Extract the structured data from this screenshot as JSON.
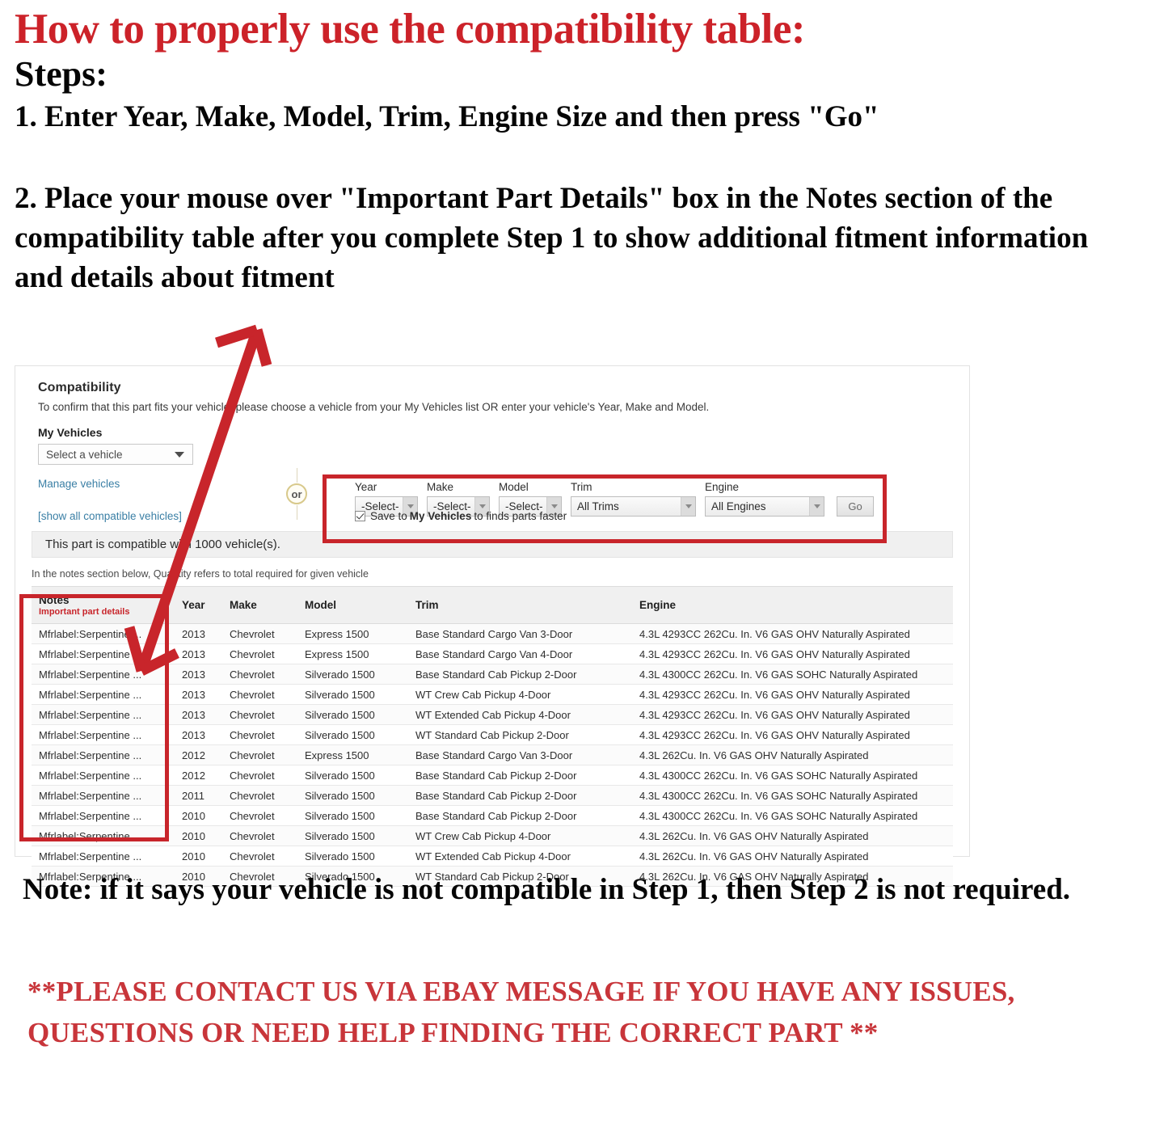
{
  "instructions": {
    "heading": "How to properly use the compatibility table:",
    "steps_label": "Steps:",
    "step1": "1. Enter Year, Make, Model, Trim, Engine Size and then press \"Go\"",
    "step2": "2. Place your mouse over \"Important Part Details\" box in the Notes section of the compatibility table after you complete Step 1 to show additional fitment information and details about fitment"
  },
  "panel": {
    "title": "Compatibility",
    "subtitle": "To confirm that this part fits your vehicle, please choose a vehicle from your My Vehicles list OR enter your vehicle's Year, Make and Model.",
    "my_vehicles_label": "My Vehicles",
    "vehicle_select_value": "Select a vehicle",
    "manage_vehicles_link": "Manage vehicles",
    "show_all_link": "[show all compatible vehicles]",
    "or_label": "or",
    "compatible_banner": "This part is compatible with 1000 vehicle(s).",
    "notes_hint": "In the notes section below, Quantity refers to total required for given vehicle"
  },
  "picker": {
    "fields": [
      {
        "label": "Year",
        "value": "-Select-"
      },
      {
        "label": "Make",
        "value": "-Select-"
      },
      {
        "label": "Model",
        "value": "-Select-"
      },
      {
        "label": "Trim",
        "value": "All Trims"
      },
      {
        "label": "Engine",
        "value": "All Engines"
      }
    ],
    "go_label": "Go",
    "save_prefix": "Save to",
    "save_bold": "My Vehicles",
    "save_suffix": "to finds parts faster",
    "save_checked": true
  },
  "table": {
    "headers": {
      "notes": "Notes",
      "notes_sub": "Important part details",
      "year": "Year",
      "make": "Make",
      "model": "Model",
      "trim": "Trim",
      "engine": "Engine"
    },
    "rows": [
      {
        "notes": "Mfrlabel:Serpentine ...",
        "year": "2013",
        "make": "Chevrolet",
        "model": "Express 1500",
        "trim": "Base Standard Cargo Van 3-Door",
        "engine": "4.3L 4293CC 262Cu. In. V6 GAS OHV Naturally Aspirated"
      },
      {
        "notes": "Mfrlabel:Serpentine ...",
        "year": "2013",
        "make": "Chevrolet",
        "model": "Express 1500",
        "trim": "Base Standard Cargo Van 4-Door",
        "engine": "4.3L 4293CC 262Cu. In. V6 GAS OHV Naturally Aspirated"
      },
      {
        "notes": "Mfrlabel:Serpentine ...",
        "year": "2013",
        "make": "Chevrolet",
        "model": "Silverado 1500",
        "trim": "Base Standard Cab Pickup 2-Door",
        "engine": "4.3L 4300CC 262Cu. In. V6 GAS SOHC Naturally Aspirated"
      },
      {
        "notes": "Mfrlabel:Serpentine ...",
        "year": "2013",
        "make": "Chevrolet",
        "model": "Silverado 1500",
        "trim": "WT Crew Cab Pickup 4-Door",
        "engine": "4.3L 4293CC 262Cu. In. V6 GAS OHV Naturally Aspirated"
      },
      {
        "notes": "Mfrlabel:Serpentine ...",
        "year": "2013",
        "make": "Chevrolet",
        "model": "Silverado 1500",
        "trim": "WT Extended Cab Pickup 4-Door",
        "engine": "4.3L 4293CC 262Cu. In. V6 GAS OHV Naturally Aspirated"
      },
      {
        "notes": "Mfrlabel:Serpentine ...",
        "year": "2013",
        "make": "Chevrolet",
        "model": "Silverado 1500",
        "trim": "WT Standard Cab Pickup 2-Door",
        "engine": "4.3L 4293CC 262Cu. In. V6 GAS OHV Naturally Aspirated"
      },
      {
        "notes": "Mfrlabel:Serpentine ...",
        "year": "2012",
        "make": "Chevrolet",
        "model": "Express 1500",
        "trim": "Base Standard Cargo Van 3-Door",
        "engine": "4.3L 262Cu. In. V6 GAS OHV Naturally Aspirated"
      },
      {
        "notes": "Mfrlabel:Serpentine ...",
        "year": "2012",
        "make": "Chevrolet",
        "model": "Silverado 1500",
        "trim": "Base Standard Cab Pickup 2-Door",
        "engine": "4.3L 4300CC 262Cu. In. V6 GAS SOHC Naturally Aspirated"
      },
      {
        "notes": "Mfrlabel:Serpentine ...",
        "year": "2011",
        "make": "Chevrolet",
        "model": "Silverado 1500",
        "trim": "Base Standard Cab Pickup 2-Door",
        "engine": "4.3L 4300CC 262Cu. In. V6 GAS SOHC Naturally Aspirated"
      },
      {
        "notes": "Mfrlabel:Serpentine ...",
        "year": "2010",
        "make": "Chevrolet",
        "model": "Silverado 1500",
        "trim": "Base Standard Cab Pickup 2-Door",
        "engine": "4.3L 4300CC 262Cu. In. V6 GAS SOHC Naturally Aspirated"
      },
      {
        "notes": "Mfrlabel:Serpentine ...",
        "year": "2010",
        "make": "Chevrolet",
        "model": "Silverado 1500",
        "trim": "WT Crew Cab Pickup 4-Door",
        "engine": "4.3L 262Cu. In. V6 GAS OHV Naturally Aspirated"
      },
      {
        "notes": "Mfrlabel:Serpentine ...",
        "year": "2010",
        "make": "Chevrolet",
        "model": "Silverado 1500",
        "trim": "WT Extended Cab Pickup 4-Door",
        "engine": "4.3L 262Cu. In. V6 GAS OHV Naturally Aspirated"
      },
      {
        "notes": "Mfrlabel:Serpentine ...",
        "year": "2010",
        "make": "Chevrolet",
        "model": "Silverado 1500",
        "trim": "WT Standard Cab Pickup 2-Door",
        "engine": "4.3L 262Cu. In. V6 GAS OHV Naturally Aspirated"
      }
    ]
  },
  "footer": {
    "note": "Note: if it says your vehicle is not compatible in Step 1, then Step 2 is not required.",
    "contact": "**PLEASE CONTACT US VIA EBAY MESSAGE IF YOU HAVE ANY ISSUES, QUESTIONS OR NEED HELP FINDING THE CORRECT PART **"
  },
  "colors": {
    "accent_red": "#CC2229",
    "box_red": "#C8252B",
    "link_blue": "#3a7fa5"
  }
}
